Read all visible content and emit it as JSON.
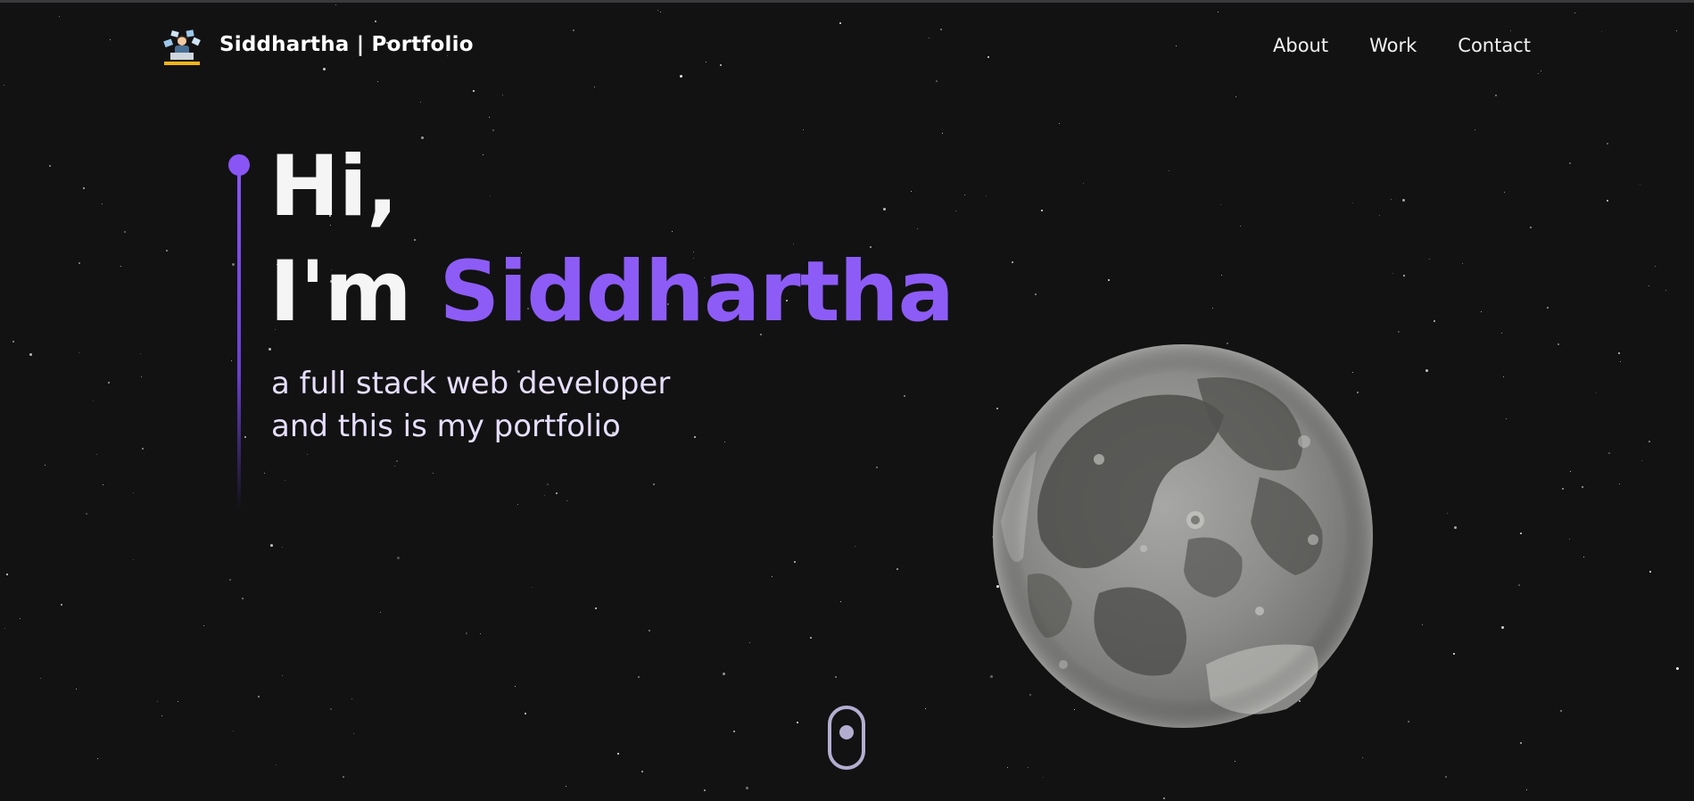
{
  "header": {
    "logo_icon": "developer-at-desk-logo",
    "brand": "Siddhartha | Portfolio",
    "nav": [
      {
        "label": "About"
      },
      {
        "label": "Work"
      },
      {
        "label": "Contact"
      }
    ]
  },
  "hero": {
    "greeting": "Hi,",
    "im": "I'm",
    "name": "Siddhartha",
    "subtitle_line1": "a full stack web developer",
    "subtitle_line2": "and this is my portfolio"
  },
  "visual": {
    "moon_icon": "moon-image",
    "scroll_icon": "mouse-scroll-icon"
  },
  "colors": {
    "background": "#121213",
    "accent": "#8d5cf6",
    "text": "#f5f5f5",
    "subtitle": "#e6defc",
    "scroll": "#b3aed0"
  }
}
